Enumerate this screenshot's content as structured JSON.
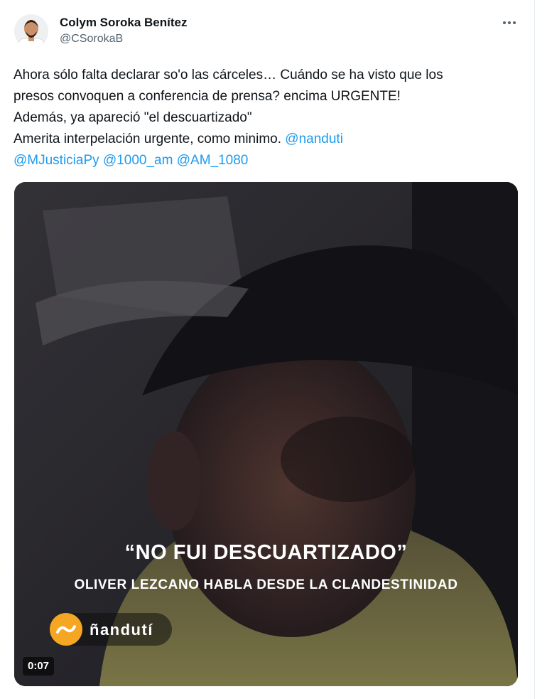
{
  "tweet": {
    "author": {
      "name": "Colym Soroka Benítez",
      "handle": "@CSorokaB"
    },
    "more_icon": "ellipsis-icon",
    "text_lines": [
      "Ahora sólo falta declarar so'o las cárceles… Cuándo se ha visto que los",
      "presos convoquen a conferencia de prensa? encima URGENTE!",
      "Además, ya apareció \"el descuartizado\"",
      "Amerita interpelación urgente, como minimo."
    ],
    "mentions": [
      "@nanduti",
      "@MJusticiaPy",
      "@1000_am",
      "@AM_1080"
    ]
  },
  "video": {
    "title": "“NO FUI DESCUARTIZADO”",
    "subtitle": "OLIVER LEZCANO HABLA DESDE LA CLANDESTINIDAD",
    "brand": "ñandutí",
    "duration": "0:07"
  },
  "colors": {
    "mention": "#1d9bf0",
    "brand_orange": "#f5a623"
  }
}
